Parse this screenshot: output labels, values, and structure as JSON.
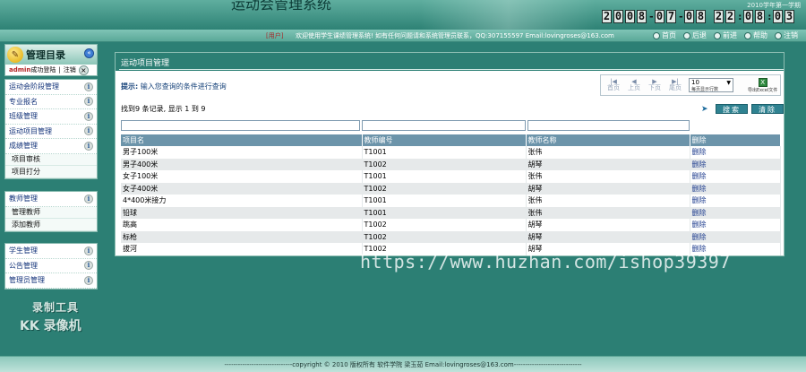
{
  "header": {
    "system_title": "运动会管理系统",
    "semester": "2010学年第一学期",
    "clock_digits": [
      "2",
      "0",
      "0",
      "8",
      "0",
      "7",
      "0",
      "8",
      "2",
      "2",
      "0",
      "8",
      "0",
      "3"
    ]
  },
  "topbar": {
    "user_label": "[用户]",
    "welcome": "欢迎使用学生课绩管理系统! 如有任何问题请和系统管理员联系，QQ:307155597 Email:lovingroses@163.com",
    "links": [
      {
        "icon": "home-icon",
        "label": "首页"
      },
      {
        "icon": "back-icon",
        "label": "后退"
      },
      {
        "icon": "forward-icon",
        "label": "前进"
      },
      {
        "icon": "help-icon",
        "label": "帮助"
      },
      {
        "icon": "logout-icon",
        "label": "注销"
      }
    ]
  },
  "sidebar": {
    "title": "管理目录",
    "login_user": "admin",
    "login_text": "成功登陆",
    "divider": "|",
    "logout": "注销",
    "group1": {
      "items": [
        "运动会阶段管理",
        "专业报名",
        "班级管理",
        "运动项目管理",
        "成绩管理"
      ],
      "subitems": [
        "项目审核",
        "项目打分"
      ]
    },
    "group2": {
      "items": [
        "教师管理"
      ],
      "subitems": [
        "管理教师",
        "添加教师"
      ]
    },
    "group3": {
      "items": [
        "学生管理",
        "公告管理",
        "管理员管理"
      ]
    },
    "watermark_tool": "录制工具",
    "watermark_kk": "KK 录像机"
  },
  "content": {
    "title": "运动项目管理",
    "tip_label": "提示:",
    "tip_text": "  输入您查询的条件进行查询",
    "pager": {
      "first": "首页",
      "prev": "上页",
      "next": "下页",
      "last": "尾页",
      "page_size": "10",
      "page_size_caption": "每页显示行数",
      "export": "导出Excel文件"
    },
    "record_info": "找到9 条记录, 显示 1 到 9",
    "search_button": "搜索",
    "clear_button": "清除",
    "columns": [
      "项目名",
      "教师编号",
      "教师名称",
      "删除"
    ],
    "rows": [
      [
        "男子100米",
        "T1001",
        "张伟",
        "删除"
      ],
      [
        "男子400米",
        "T1002",
        "胡琴",
        "删除"
      ],
      [
        "女子100米",
        "T1001",
        "张伟",
        "删除"
      ],
      [
        "女子400米",
        "T1002",
        "胡琴",
        "删除"
      ],
      [
        "4*400米接力",
        "T1001",
        "张伟",
        "删除"
      ],
      [
        "铅球",
        "T1001",
        "张伟",
        "删除"
      ],
      [
        "跳高",
        "T1002",
        "胡琴",
        "删除"
      ],
      [
        "标枪",
        "T1002",
        "胡琴",
        "删除"
      ],
      [
        "拔河",
        "T1002",
        "胡琴",
        "删除"
      ]
    ]
  },
  "overlay": {
    "url_watermark": "https://www.huzhan.com/ishop39397"
  },
  "footer": {
    "text": "------------------------------copyright © 2010 版权所有 软件学院 梁玉茹  Email:lovingroses@163.com------------------------------"
  }
}
